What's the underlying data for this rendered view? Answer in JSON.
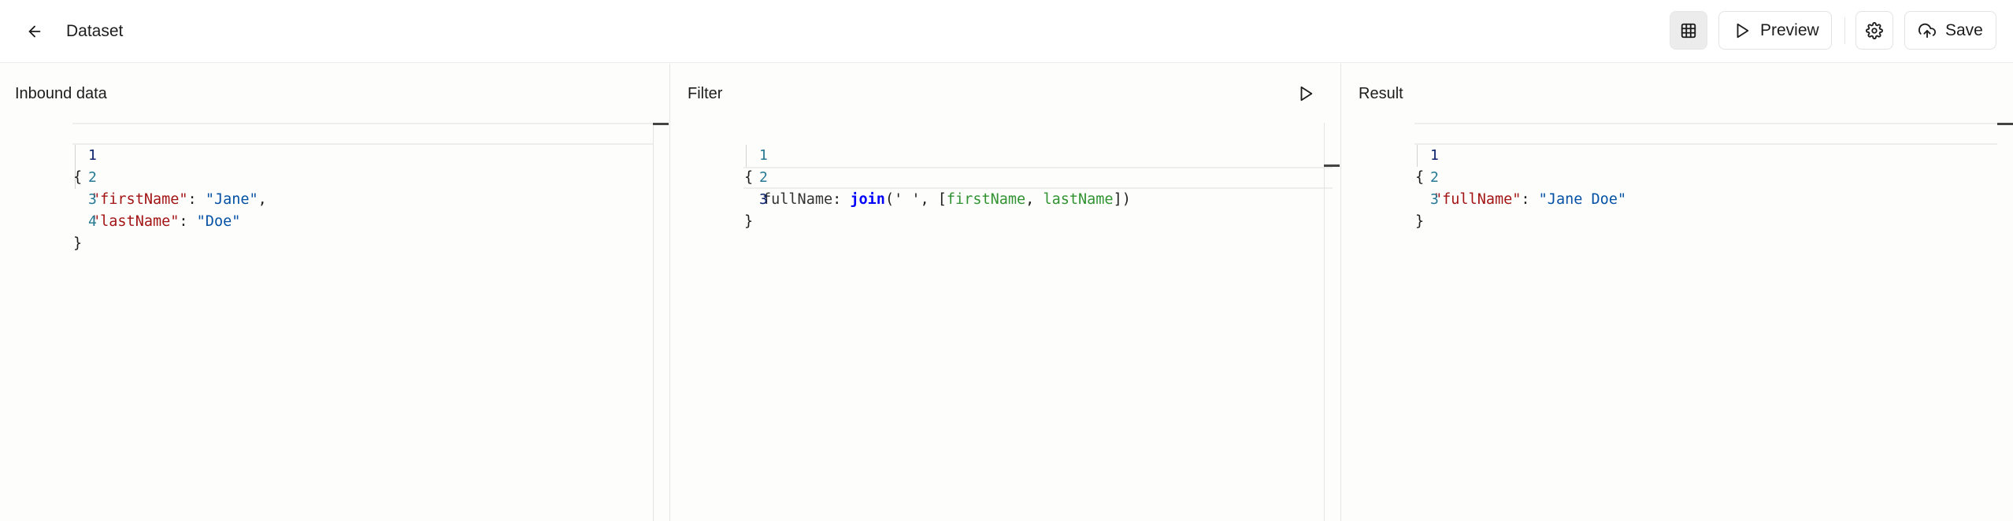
{
  "header": {
    "title": "Dataset",
    "preview_label": "Preview",
    "save_label": "Save",
    "icons": {
      "back": "arrow-left-icon",
      "grid": "table-grid-icon",
      "preview": "play-icon",
      "settings": "gear-icon",
      "save": "cloud-upload-icon"
    }
  },
  "panels": {
    "inbound": {
      "title": "Inbound data",
      "line_numbers": [
        "1",
        "2",
        "3",
        "4"
      ],
      "code": {
        "open_brace": "{",
        "key1": "\"firstName\"",
        "sep1": ": ",
        "val1": "\"Jane\"",
        "comma1": ",",
        "key2": "\"lastName\"",
        "sep2": ": ",
        "val2": "\"Doe\"",
        "close_brace": "}"
      }
    },
    "filter": {
      "title": "Filter",
      "line_numbers": [
        "1",
        "2",
        "3"
      ],
      "code": {
        "open_brace": "{",
        "field": "fullName",
        "colon": ": ",
        "fn": "join",
        "args_open": "(' ', [",
        "id1": "firstName",
        "comma": ", ",
        "id2": "lastName",
        "args_close": "])",
        "close_brace": "}"
      },
      "run_icon": "play-icon"
    },
    "result": {
      "title": "Result",
      "line_numbers": [
        "1",
        "2",
        "3"
      ],
      "code": {
        "open_brace": "{",
        "key1": "\"fullName\"",
        "sep1": ": ",
        "val1": "\"Jane Doe\"",
        "close_brace": "}"
      }
    }
  },
  "colors": {
    "json_key": "#a31515",
    "json_string": "#0451a5",
    "function": "#0000ff",
    "identifier": "#319331",
    "line_number": "#237893"
  }
}
